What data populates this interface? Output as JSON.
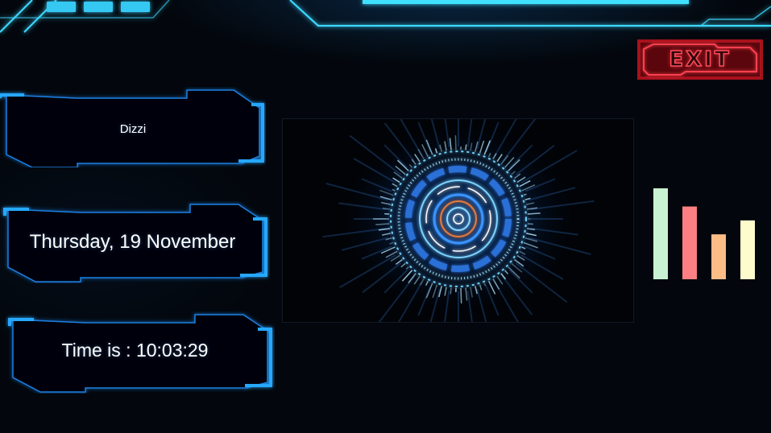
{
  "panels": {
    "user_name": "Dizzi",
    "date": "Thursday, 19 November",
    "time": "Time is : 10:03:29"
  },
  "exit_button": {
    "label": "EXIT"
  },
  "audio_levels": {
    "values": [
      0.85,
      0.68,
      0.42,
      0.55
    ],
    "colors": [
      "#c8f2d2",
      "#fc7f83",
      "#fcbc86",
      "#fefccc"
    ]
  },
  "theme": {
    "accent": "#19a8ff",
    "hud_cyan": "#3dd8ff",
    "exit_red": "#ff3040"
  }
}
